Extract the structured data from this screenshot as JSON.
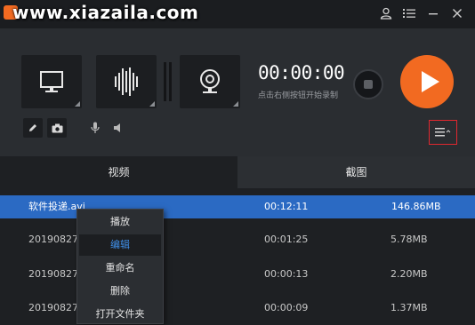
{
  "watermark": "www.xiazaila.com",
  "window": {
    "user_icon": "user-icon",
    "menu_icon": "list-menu-icon",
    "minimize_icon": "minimize-icon",
    "close_icon": "close-icon"
  },
  "recorder": {
    "sources": [
      {
        "name": "screen",
        "icon": "monitor-icon"
      },
      {
        "name": "audio",
        "icon": "waveform-icon"
      },
      {
        "name": "webcam",
        "icon": "webcam-icon"
      }
    ],
    "timer": "00:00:00",
    "hint": "点击右侧按钮开始录制",
    "tools": [
      "pencil-icon",
      "camera-icon",
      "microphone-icon",
      "speaker-icon"
    ],
    "accent_color": "#f26a21"
  },
  "tabs": [
    {
      "label": "视频",
      "active": true
    },
    {
      "label": "截图",
      "active": false
    }
  ],
  "files": [
    {
      "name": "软件投递.avi",
      "duration": "00:12:11",
      "size": "146.86MB",
      "selected": true
    },
    {
      "name": "20190827",
      "duration": "00:01:25",
      "size": "5.78MB",
      "selected": false
    },
    {
      "name": "20190827",
      "duration": "00:00:13",
      "size": "2.20MB",
      "selected": false
    },
    {
      "name": "20190827",
      "duration": "00:00:09",
      "size": "1.37MB",
      "selected": false
    }
  ],
  "context_menu": {
    "items": [
      "播放",
      "编辑",
      "重命名",
      "删除",
      "打开文件夹"
    ],
    "highlighted_index": 1
  },
  "colors": {
    "selection": "#2b6ac3",
    "menu_highlight_text": "#3f8fe8",
    "annotation_border": "#e0282f"
  }
}
